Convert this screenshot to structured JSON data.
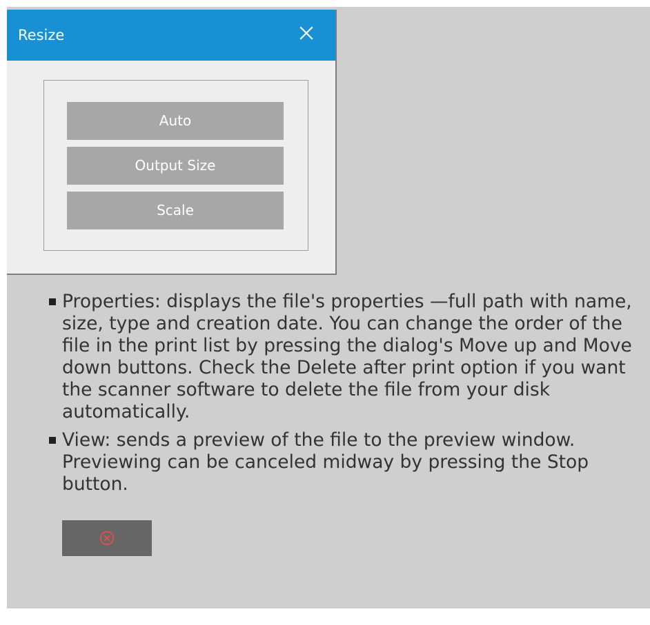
{
  "dialog": {
    "title": "Resize",
    "close_icon": "close-icon",
    "buttons": [
      {
        "label": "Auto"
      },
      {
        "label": "Output Size"
      },
      {
        "label": "Scale"
      }
    ]
  },
  "colors": {
    "titlebar": "#1790d4",
    "button": "#a7a7a7",
    "background": "#cfcfcf",
    "stop_button": "#666666",
    "stop_icon": "#d9524f"
  },
  "bullets": [
    {
      "text": "Properties: displays the file's properties —full path with name, size, type and creation date. You can change the order of the file in the print list by pressing the dialog's Move up and Move down buttons. Check the Delete after print option if you want the scanner software to delete the file from your disk automatically."
    },
    {
      "text": "View: sends a preview of the file to the preview window. Previewing can be canceled midway by pressing the Stop button."
    }
  ],
  "stop_button": {
    "icon": "stop-circle-x-icon"
  }
}
